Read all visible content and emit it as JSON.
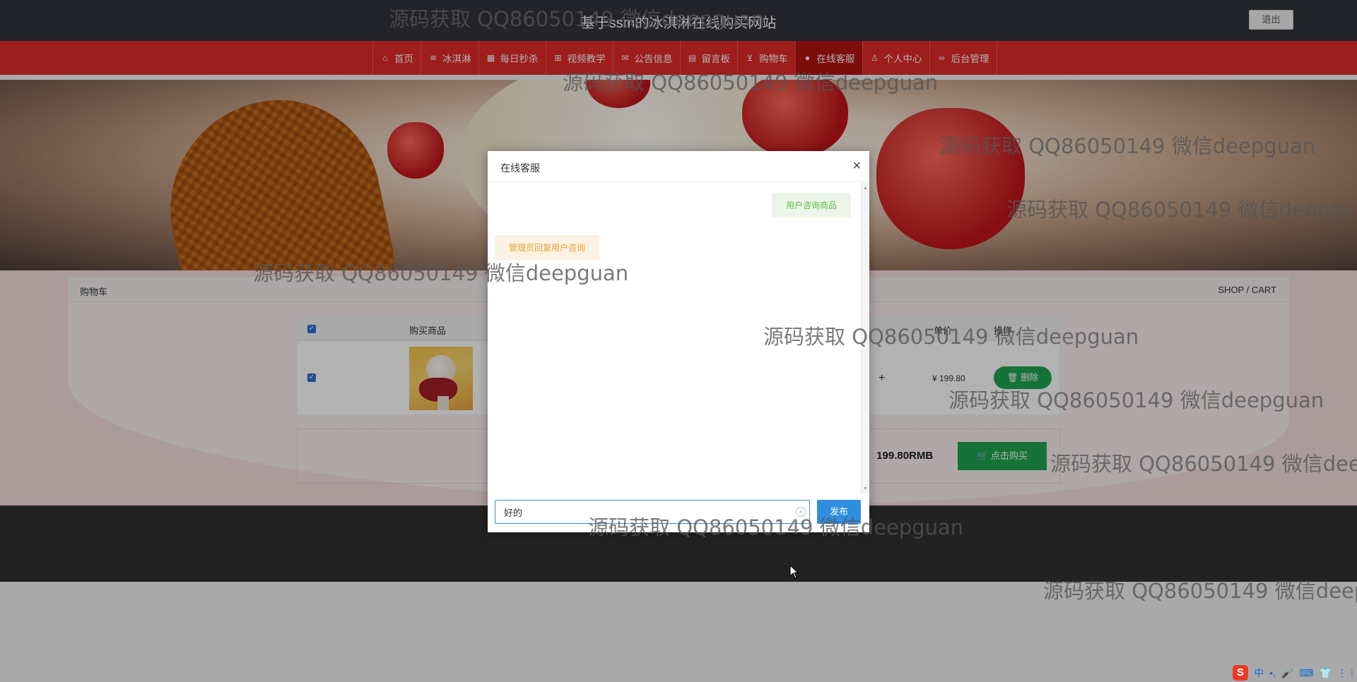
{
  "header": {
    "site_title": "基于ssm的冰淇淋在线购买网站",
    "logout_label": "退出"
  },
  "nav": {
    "items": [
      {
        "label": "首页",
        "icon": "home-icon",
        "glyph": "⌂"
      },
      {
        "label": "冰淇淋",
        "icon": "layers-icon",
        "glyph": "≋"
      },
      {
        "label": "每日秒杀",
        "icon": "calendar-icon",
        "glyph": "▦"
      },
      {
        "label": "视频教学",
        "icon": "grid-icon",
        "glyph": "⊞"
      },
      {
        "label": "公告信息",
        "icon": "mail-icon",
        "glyph": "✉"
      },
      {
        "label": "留言板",
        "icon": "note-icon",
        "glyph": "▤"
      },
      {
        "label": "购物车",
        "icon": "cart-icon",
        "glyph": "⊻"
      },
      {
        "label": "在线客服",
        "icon": "chat-icon",
        "glyph": "●"
      },
      {
        "label": "个人中心",
        "icon": "user-icon",
        "glyph": "♙"
      },
      {
        "label": "后台管理",
        "icon": "link-icon",
        "glyph": "∞"
      }
    ],
    "active_index": 7
  },
  "page": {
    "breadcrumb_left": "购物车",
    "breadcrumb_right": "SHOP / CART",
    "table_header": {
      "product": "购买商品",
      "price": "单价",
      "action": "操作"
    },
    "item": {
      "plus": "+",
      "price": "¥ 199.80",
      "delete_label": "删除"
    },
    "total_label": "：  199.80RMB",
    "buy_label": "点击购买"
  },
  "dialog": {
    "title": "在线客服",
    "close": "×",
    "messages": {
      "user": "用户咨询商品",
      "admin": "管理员回复用户咨询"
    },
    "input_value": "好的",
    "send_label": "发布"
  },
  "watermark_text": "源码获取 QQ86050149 微信deepguan",
  "ime": {
    "logo": "S",
    "items": [
      "中",
      "•,",
      "🎤",
      "⌨",
      "👕",
      "⋮⋮"
    ]
  },
  "colors": {
    "nav_red": "#e22a2a",
    "nav_active": "#b41414",
    "topbar": "#33333d",
    "green": "#1fa54f",
    "blue": "#2f8ee0"
  }
}
